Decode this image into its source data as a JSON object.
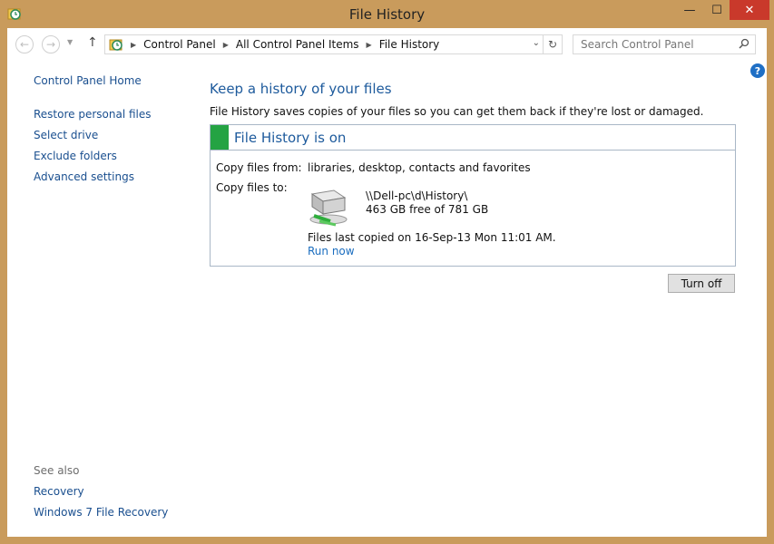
{
  "window": {
    "title": "File History",
    "minimize_glyph": "—",
    "maximize_glyph": "☐",
    "close_glyph": "✕"
  },
  "nav": {
    "back_glyph": "←",
    "forward_glyph": "→",
    "recent_glyph": "▼",
    "up_glyph": "↑",
    "breadcrumbs": [
      "Control Panel",
      "All Control Panel Items",
      "File History"
    ],
    "address_drop_glyph": "⌄",
    "refresh_glyph": "↻",
    "search_placeholder": "Search Control Panel"
  },
  "help_glyph": "?",
  "sidebar": {
    "home": "Control Panel Home",
    "links": [
      "Restore personal files",
      "Select drive",
      "Exclude folders",
      "Advanced settings"
    ],
    "see_also_label": "See also",
    "see_also": [
      "Recovery",
      "Windows 7 File Recovery"
    ]
  },
  "main": {
    "heading": "Keep a history of your files",
    "description": "File History saves copies of your files so you can get them back if they're lost or damaged.",
    "panel_title": "File History is on",
    "copy_from_label": "Copy files from:",
    "copy_from_value": "libraries, desktop, contacts and favorites",
    "copy_to_label": "Copy files to:",
    "drive_path": "\\\\Dell-pc\\d\\History\\",
    "drive_free": "463 GB free of 781 GB",
    "last_copied": "Files last copied on 16-Sep-13 Mon 11:01 AM.",
    "run_now": "Run now",
    "turn_off": "Turn off"
  },
  "colors": {
    "frame": "#c99b5c",
    "close": "#c9392b",
    "status_on": "#24a343",
    "heading": "#1d5a9c",
    "link": "#1a4f8f"
  }
}
